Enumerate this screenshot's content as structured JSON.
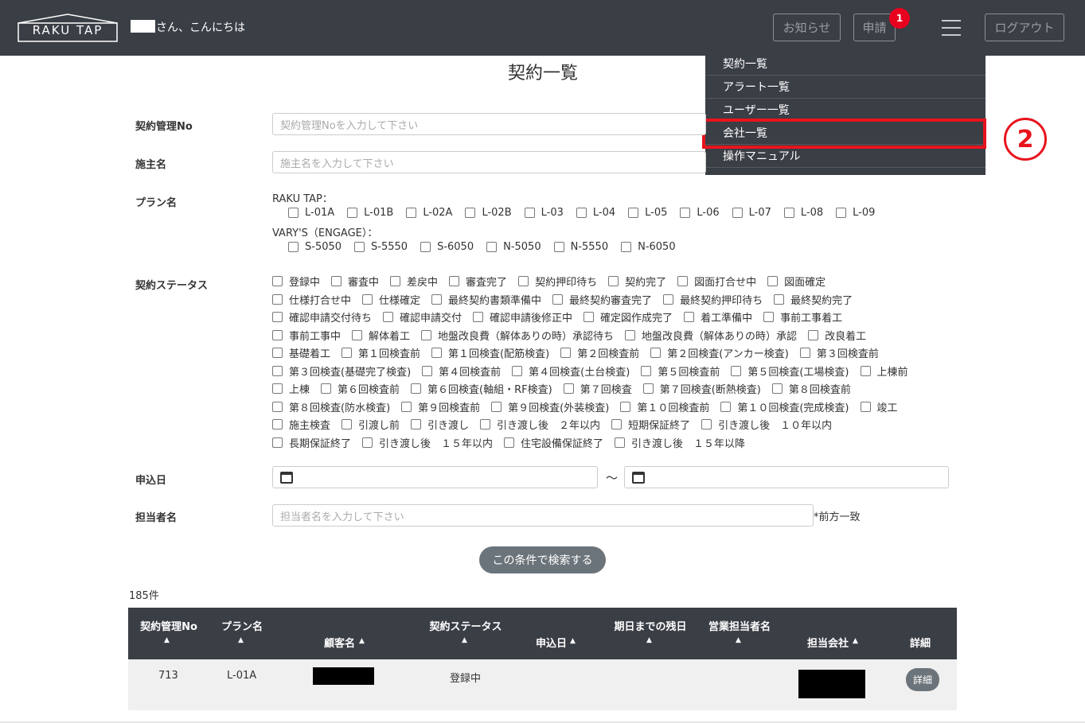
{
  "header": {
    "logo": "RAKU TAP",
    "greeting": "さん、こんにちは",
    "notice_label": "お知らせ",
    "apply_label": "申請",
    "apply_badge": "1",
    "logout_label": "ログアウト"
  },
  "menu": {
    "items": [
      "契約一覧",
      "アラート一覧",
      "ユーザー一覧",
      "会社一覧",
      "操作マニュアル"
    ],
    "step_marker": "2",
    "accent": "#e8141d"
  },
  "page": {
    "title": "契約一覧"
  },
  "form": {
    "contract_no": {
      "label": "契約管理No",
      "placeholder": "契約管理Noを入力して下さい"
    },
    "owner": {
      "label": "施主名",
      "placeholder": "施主名を入力して下さい"
    },
    "plan": {
      "label": "プラン名",
      "group1_title": "RAKU TAP：",
      "group1": [
        "L-01A",
        "L-01B",
        "L-02A",
        "L-02B",
        "L-03",
        "L-04",
        "L-05",
        "L-06",
        "L-07",
        "L-08",
        "L-09"
      ],
      "group2_title": "VARY'S（ENGAGE）：",
      "group2": [
        "S-5050",
        "S-5550",
        "S-6050",
        "N-5050",
        "N-5550",
        "N-6050"
      ]
    },
    "status": {
      "label": "契約ステータス",
      "rows": [
        [
          "登録中",
          "審査中",
          "差戻中",
          "審査完了",
          "契約押印待ち",
          "契約完了",
          "図面打合せ中",
          "図面確定"
        ],
        [
          "仕様打合せ中",
          "仕様確定",
          "最終契約書類準備中",
          "最終契約審査完了",
          "最終契約押印待ち",
          "最終契約完了"
        ],
        [
          "確認申請交付待ち",
          "確認申請交付",
          "確認申請後修正中",
          "確定図作成完了",
          "着工準備中",
          "事前工事着工"
        ],
        [
          "事前工事中",
          "解体着工",
          "地盤改良費（解体ありの時）承認待ち",
          "地盤改良費（解体ありの時）承認",
          "改良着工"
        ],
        [
          "基礎着工",
          "第１回検査前",
          "第１回検査(配筋検査)",
          "第２回検査前",
          "第２回検査(アンカー検査)",
          "第３回検査前"
        ],
        [
          "第３回検査(基礎完了検査)",
          "第４回検査前",
          "第４回検査(土台検査)",
          "第５回検査前",
          "第５回検査(工場検査)",
          "上棟前"
        ],
        [
          "上棟",
          "第６回検査前",
          "第６回検査(軸組・RF検査)",
          "第７回検査",
          "第７回検査(断熱検査)",
          "第８回検査前"
        ],
        [
          "第８回検査(防水検査)",
          "第９回検査前",
          "第９回検査(外装検査)",
          "第１０回検査前",
          "第１０回検査(完成検査)",
          "竣工"
        ],
        [
          "施主検査",
          "引渡し前",
          "引き渡し",
          "引き渡し後　２年以内",
          "短期保証終了",
          "引き渡し後　１０年以内"
        ],
        [
          "長期保証終了",
          "引き渡し後　１５年以内",
          "住宅設備保証終了",
          "引き渡し後　１５年以降"
        ]
      ]
    },
    "apply_date": {
      "label": "申込日",
      "separator": "～"
    },
    "staff": {
      "label": "担当者名",
      "placeholder": "担当者名を入力して下さい",
      "suffix": "*前方一致"
    },
    "search_button": "この条件で検索する"
  },
  "results": {
    "count": "185件",
    "columns": {
      "no": "契約管理No",
      "plan": "プラン名",
      "customer": "顧客名",
      "status": "契約ステータス",
      "date": "申込日",
      "remaining": "期日までの残日",
      "sales": "営業担当者名",
      "company": "担当会社",
      "detail": "詳細"
    },
    "sort_icon": "▲",
    "rows": [
      {
        "no": "713",
        "plan": "L-01A",
        "status": "登録中",
        "detail": "詳細"
      }
    ]
  }
}
